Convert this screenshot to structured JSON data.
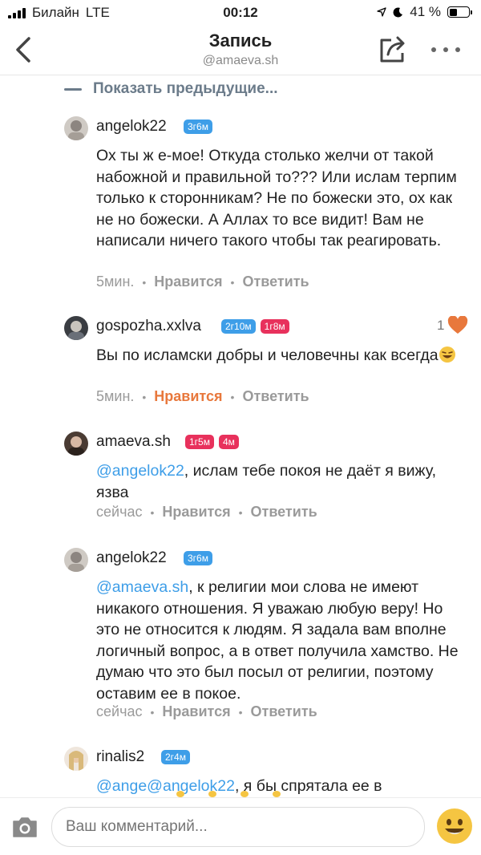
{
  "status_bar": {
    "carrier": "Билайн",
    "network": "LTE",
    "time": "00:12",
    "battery": "41 %",
    "battery_level": 0.41
  },
  "header": {
    "title": "Запись",
    "subtitle": "@amaeva.sh"
  },
  "show_previous": "Показать предыдущие...",
  "comments": [
    {
      "username": "angelok22",
      "badges": [
        {
          "text": "3г6м",
          "color": "#3e9ee8"
        }
      ],
      "text": "Ох ты ж е-мое! Откуда столько желчи от такой набожной и правильной то??? Или ислам терпим только к сторонникам? Не по божески это, ох как не но божески. А Аллах то все видит! Вам не написали ничего такого чтобы так реагировать.",
      "time": "5мин.",
      "like": "Нравится",
      "reply": "Ответить"
    },
    {
      "username": "gospozha.xxlva",
      "badges": [
        {
          "text": "2г10м",
          "color": "#3e9ee8"
        },
        {
          "text": "1г8м",
          "color": "#e8315c"
        }
      ],
      "text": "Вы по исламски добры и человечны как всегда",
      "time": "5мин.",
      "like": "Нравится",
      "reply": "Ответить",
      "like_count": "1"
    },
    {
      "username": "amaeva.sh",
      "badges": [
        {
          "text": "1г5м",
          "color": "#e8315c"
        },
        {
          "text": "4м",
          "color": "#e8315c"
        }
      ],
      "mention": "@angelok22",
      "text": ", ислам тебе покоя не даёт я вижу, язва",
      "time": "сейчас",
      "like": "Нравится",
      "reply": "Ответить"
    },
    {
      "username": "angelok22",
      "badges": [
        {
          "text": "3г6м",
          "color": "#3e9ee8"
        }
      ],
      "mention": "@amaeva.sh",
      "text": ", к религии мои слова не имеют никакого отношения. Я уважаю любую веру! Но это не относится к людям. Я задала вам вполне логичный вопрос, а в ответ получила хамство. Не думаю что это был посыл от религии, поэтому оставим ее в покое.",
      "time": "сейчас",
      "like": "Нравится",
      "reply": "Ответить"
    },
    {
      "username": "rinalis2",
      "badges": [
        {
          "text": "2г4м",
          "color": "#3e9ee8"
        }
      ],
      "mention": "@ange@angelok22",
      "text": ", я бы спрятала ее в"
    }
  ],
  "input": {
    "placeholder": "Ваш комментарий..."
  },
  "icons": {
    "back": "chevron-left-icon",
    "share": "share-icon",
    "more": "more-horizontal-icon",
    "camera": "camera-icon",
    "emoji": "smiley-emoji-icon",
    "heart": "heart-icon",
    "moon": "moon-icon",
    "location": "location-arrow-icon"
  },
  "colors": {
    "accent": "#3e9ee8",
    "liked": "#e8783c",
    "badge_red": "#e8315c",
    "muted": "#9a9a9a"
  }
}
